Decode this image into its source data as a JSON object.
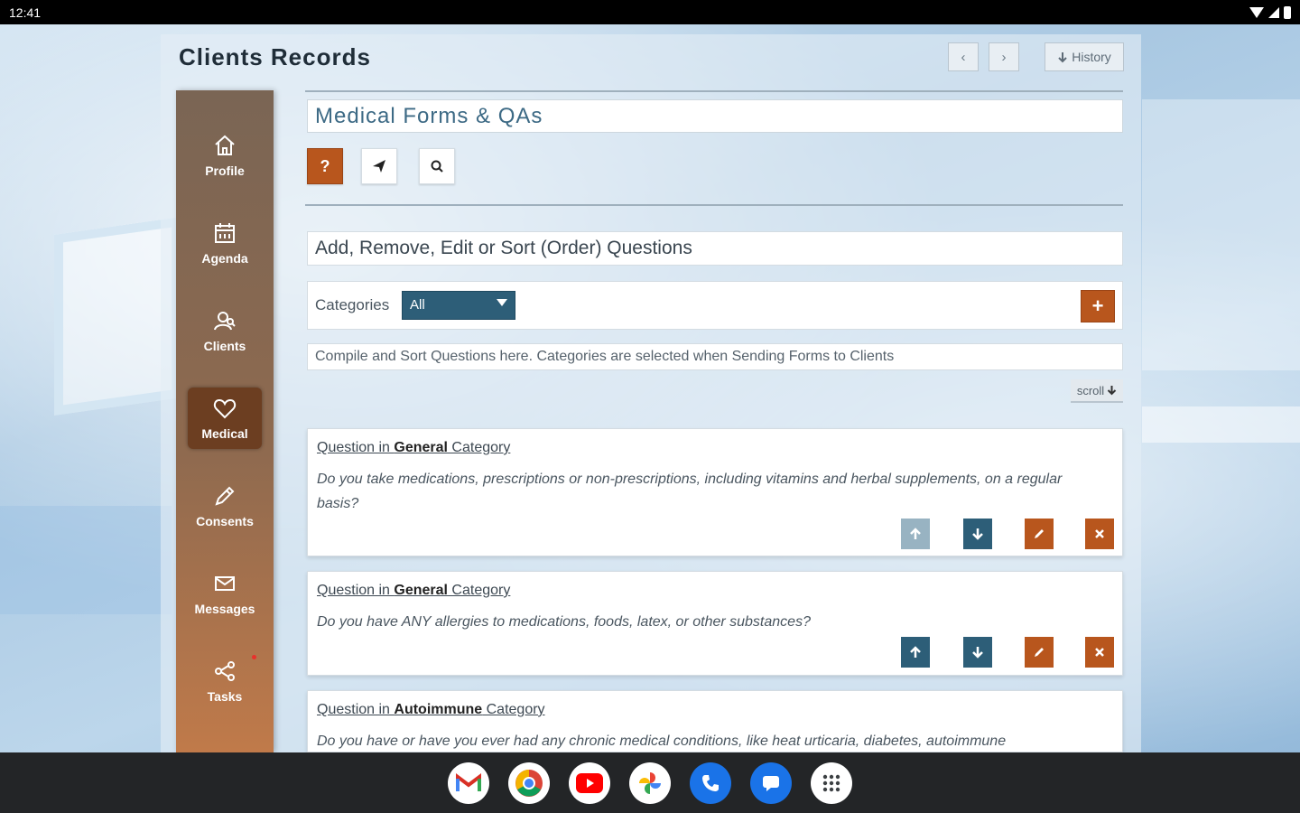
{
  "status_bar": {
    "time": "12:41"
  },
  "app": {
    "title": "Clients Records",
    "prev_label": "‹",
    "next_label": "›",
    "history_label": "History"
  },
  "sidebar": {
    "items": [
      {
        "label": "Profile",
        "icon": "home-icon"
      },
      {
        "label": "Agenda",
        "icon": "calendar-icon"
      },
      {
        "label": "Clients",
        "icon": "person-search-icon"
      },
      {
        "label": "Medical",
        "icon": "heart-icon",
        "active": true
      },
      {
        "label": "Consents",
        "icon": "pencil-icon"
      },
      {
        "label": "Messages",
        "icon": "mail-icon"
      },
      {
        "label": "Tasks",
        "icon": "share-icon"
      }
    ]
  },
  "content": {
    "section_title": "Medical Forms & QAs",
    "help_label": "?",
    "subtitle": "Add, Remove, Edit or Sort (Order) Questions",
    "categories_label": "Categories",
    "category_selected": "All",
    "add_label": "+",
    "hint": "Compile and Sort Questions here. Categories are selected when Sending Forms to Clients",
    "scroll_label": "scroll"
  },
  "questions": [
    {
      "prefix": "Question in ",
      "category": "General",
      "suffix": " Category",
      "text": "Do you take medications, prescriptions or non-prescriptions, including vitamins and herbal supplements, on a regular basis?"
    },
    {
      "prefix": "Question in ",
      "category": "General",
      "suffix": " Category",
      "text": "Do you have ANY allergies to medications, foods, latex, or other substances?"
    },
    {
      "prefix": "Question in ",
      "category": "Autoimmune",
      "suffix": " Category",
      "text": "Do you have or have you ever had any chronic medical conditions, like heat urticaria, diabetes, autoimmune"
    }
  ],
  "taskbar": {
    "apps": [
      "gmail-icon",
      "chrome-icon",
      "youtube-icon",
      "photos-icon",
      "phone-icon",
      "messages-icon",
      "apps-grid-icon"
    ]
  },
  "colors": {
    "accent_orange": "#b8561d",
    "accent_teal": "#2d5e78",
    "sidebar_active": "#6c3e21"
  }
}
